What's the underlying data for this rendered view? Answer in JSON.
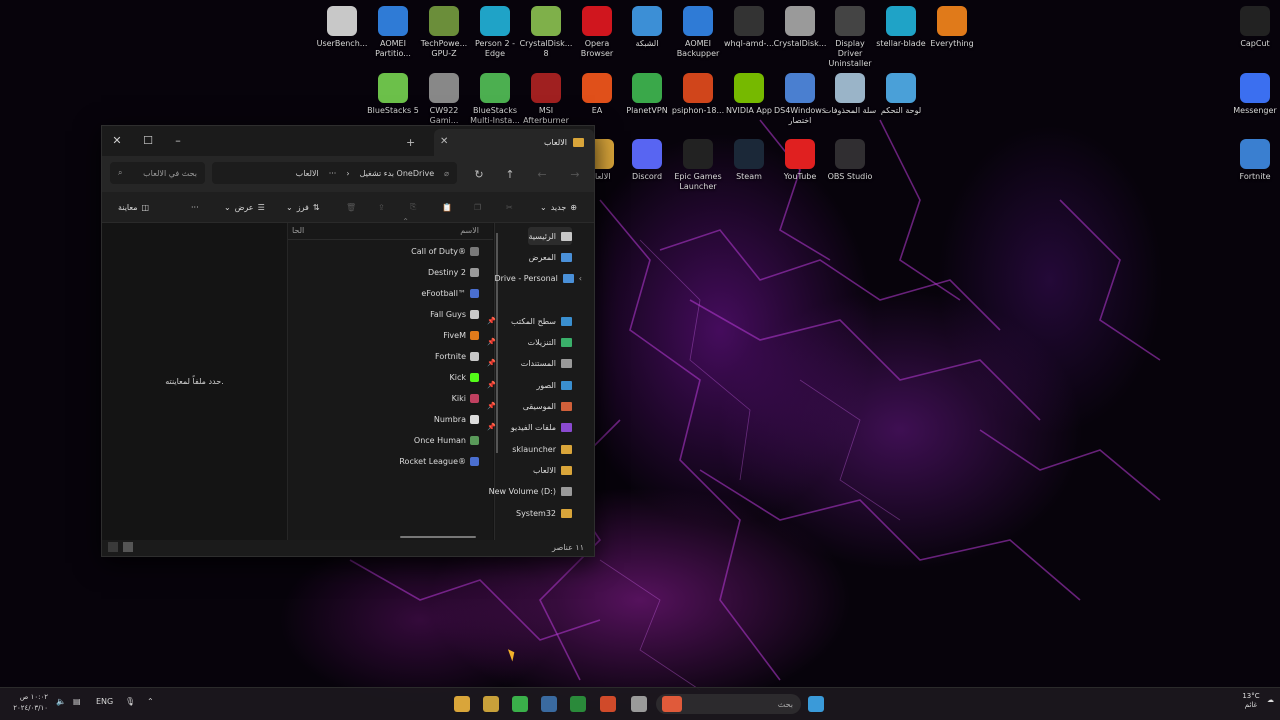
{
  "desktop": {
    "icons": [
      {
        "label": "UserBench...",
        "icon": "gauge-icon",
        "color": "#c8c8c8"
      },
      {
        "label": "AOMEI Partitio...",
        "icon": "aomei-partition-icon",
        "color": "#2f7bd6"
      },
      {
        "label": "TechPowe... GPU-Z",
        "icon": "gpuz-icon",
        "color": "#6b8e3a"
      },
      {
        "label": "Person 2 - Edge",
        "icon": "edge-icon",
        "color": "#1fa3c7"
      },
      {
        "label": "CrystalDisk... 8",
        "icon": "crystaldisk-icon",
        "color": "#7fb04a"
      },
      {
        "label": "Opera Browser",
        "icon": "opera-icon",
        "color": "#d0161e"
      },
      {
        "label": "الشبكة",
        "icon": "network-icon",
        "color": "#3c8fd6"
      },
      {
        "label": "AOMEI Backupper",
        "icon": "aomei-backupper-icon",
        "color": "#2f7bd6"
      },
      {
        "label": "whql-amd-...",
        "icon": "amd-driver-icon",
        "color": "#333333"
      },
      {
        "label": "CrystalDisk...",
        "icon": "crystaldisk-info-icon",
        "color": "#9a9a9a"
      },
      {
        "label": "Display Driver Uninstaller",
        "icon": "ddu-icon",
        "color": "#444444"
      },
      {
        "label": "stellar-blade",
        "icon": "edge-shortcut-icon",
        "color": "#1fa3c7"
      },
      {
        "label": "Everything",
        "icon": "everything-icon",
        "color": "#e07a1a"
      },
      {
        "label": "CapCut",
        "icon": "capcut-icon",
        "color": "#222222"
      },
      {
        "label": "BlueStacks 5",
        "icon": "bluestacks-icon",
        "color": "#6cc04a"
      },
      {
        "label": "CW922 Gami...",
        "icon": "cw922-icon",
        "color": "#888888"
      },
      {
        "label": "BlueStacks Multi-Insta...",
        "icon": "bluestacks-multi-icon",
        "color": "#4caf50"
      },
      {
        "label": "MSI Afterburner",
        "icon": "msi-afterburner-icon",
        "color": "#a02020"
      },
      {
        "label": "EA",
        "icon": "ea-icon",
        "color": "#e0501a"
      },
      {
        "label": "PlanetVPN",
        "icon": "planetvpn-icon",
        "color": "#3aa84a"
      },
      {
        "label": "psiphon-18...",
        "icon": "psiphon-icon",
        "color": "#d0451b"
      },
      {
        "label": "NVIDIA App",
        "icon": "nvidia-icon",
        "color": "#76b900"
      },
      {
        "label": "DS4Windows اختصار",
        "icon": "ds4windows-icon",
        "color": "#4a7fd0"
      },
      {
        "label": "سلة المحذوفات",
        "icon": "recycle-bin-icon",
        "color": "#9ab4c8"
      },
      {
        "label": "لوحة التحكم",
        "icon": "control-panel-icon",
        "color": "#4aa0d8"
      },
      {
        "label": "Messenger",
        "icon": "messenger-icon",
        "color": "#3b6ff0"
      },
      {
        "label": "الالعاب",
        "icon": "folder-icon",
        "color": "#d9a53a"
      },
      {
        "label": "Discord",
        "icon": "discord-icon",
        "color": "#5865f2"
      },
      {
        "label": "Epic Games Launcher",
        "icon": "epic-games-icon",
        "color": "#222222"
      },
      {
        "label": "Steam",
        "icon": "steam-icon",
        "color": "#1b2838"
      },
      {
        "label": "YouTube",
        "icon": "youtube-icon",
        "color": "#e02020"
      },
      {
        "label": "OBS Studio",
        "icon": "obs-icon",
        "color": "#302e31"
      },
      {
        "label": "Fortnite",
        "icon": "fortnite-icon",
        "color": "#3a7fd0"
      }
    ]
  },
  "explorer": {
    "tab_title": "الالعاب",
    "search_placeholder": "بحث في الالعاب",
    "path": {
      "current": "الالعاب",
      "onedrive": "بدء تشغيل OneDrive",
      "more": "···"
    },
    "toolbar": {
      "new": "جديد",
      "sort": "فرز",
      "view": "عرض",
      "more": "···",
      "preview": "معاينة"
    },
    "columns": {
      "name": "الاسم",
      "status": "الحا"
    },
    "files": [
      {
        "name": "Call of Duty®",
        "icon_color": "#7a7a7a"
      },
      {
        "name": "Destiny 2",
        "icon_color": "#9a9a9a"
      },
      {
        "name": "eFootball™",
        "icon_color": "#4a6fd0"
      },
      {
        "name": "Fall Guys",
        "icon_color": "#c8c8c8"
      },
      {
        "name": "FiveM",
        "icon_color": "#e07a1a"
      },
      {
        "name": "Fortnite",
        "icon_color": "#c8c8c8"
      },
      {
        "name": "Kick",
        "icon_color": "#53fc18"
      },
      {
        "name": "Kiki",
        "icon_color": "#c04060"
      },
      {
        "name": "Numbra",
        "icon_color": "#dcdcdc"
      },
      {
        "name": "Once Human",
        "icon_color": "#5a9a5a"
      },
      {
        "name": "Rocket League®",
        "icon_color": "#4a6fd0"
      }
    ],
    "preview_text": "حدد ملفاً لمعاينته.",
    "nav": [
      {
        "label": "الرئيسية",
        "icon": "home-icon",
        "color": "#c8c8c8",
        "pinned": false
      },
      {
        "label": "المعرض",
        "icon": "gallery-icon",
        "color": "#4a90d8",
        "pinned": false
      },
      {
        "label": "Drive - Personal",
        "icon": "onedrive-icon",
        "color": "#4a90d8",
        "pinned": false
      },
      {
        "label": "سطح المكتب",
        "icon": "desktop-icon",
        "color": "#3a8fd0",
        "pinned": true
      },
      {
        "label": "التنزيلات",
        "icon": "download-icon",
        "color": "#3ab06a",
        "pinned": true
      },
      {
        "label": "المستندات",
        "icon": "documents-icon",
        "color": "#9a9a9a",
        "pinned": true
      },
      {
        "label": "الصور",
        "icon": "pictures-icon",
        "color": "#3a8fd0",
        "pinned": true
      },
      {
        "label": "الموسيقى",
        "icon": "music-icon",
        "color": "#d0603a",
        "pinned": true
      },
      {
        "label": "ملفات الفيديو",
        "icon": "videos-icon",
        "color": "#8a4ad0",
        "pinned": true
      },
      {
        "label": "sklauncher",
        "icon": "folder-icon",
        "color": "#d9a53a",
        "pinned": false
      },
      {
        "label": "الالعاب",
        "icon": "folder-icon",
        "color": "#d9a53a",
        "pinned": false
      },
      {
        "label": "New Volume (D:)",
        "icon": "drive-icon",
        "color": "#9a9a9a",
        "pinned": false
      },
      {
        "label": "System32",
        "icon": "folder-icon",
        "color": "#d9a53a",
        "pinned": false
      }
    ],
    "status": "١١ عناصر"
  },
  "taskbar": {
    "search_placeholder": "بحث",
    "apps": [
      {
        "icon": "start-icon",
        "color": "#3a9ad9"
      },
      {
        "icon": "task-app-icon",
        "color": "#e05a3a"
      },
      {
        "icon": "file-manager-icon",
        "color": "#9a9a9a"
      },
      {
        "icon": "chrome-icon",
        "color": "#d04a2a"
      },
      {
        "icon": "chrome-alt-icon",
        "color": "#2a8a3a"
      },
      {
        "icon": "steam-icon",
        "color": "#3a6aa0"
      },
      {
        "icon": "kick-icon",
        "color": "#3ab04a"
      },
      {
        "icon": "bluestacks-icon",
        "color": "#c8a03a"
      },
      {
        "icon": "file-explorer-icon",
        "color": "#d9a53a"
      }
    ],
    "weather": {
      "temp": "13°C",
      "desc": "غائم"
    },
    "language": "ENG",
    "clock": {
      "time": "١٠:٠٢ ص",
      "date": "٢٠٢٤/٠٣/١٠"
    }
  }
}
